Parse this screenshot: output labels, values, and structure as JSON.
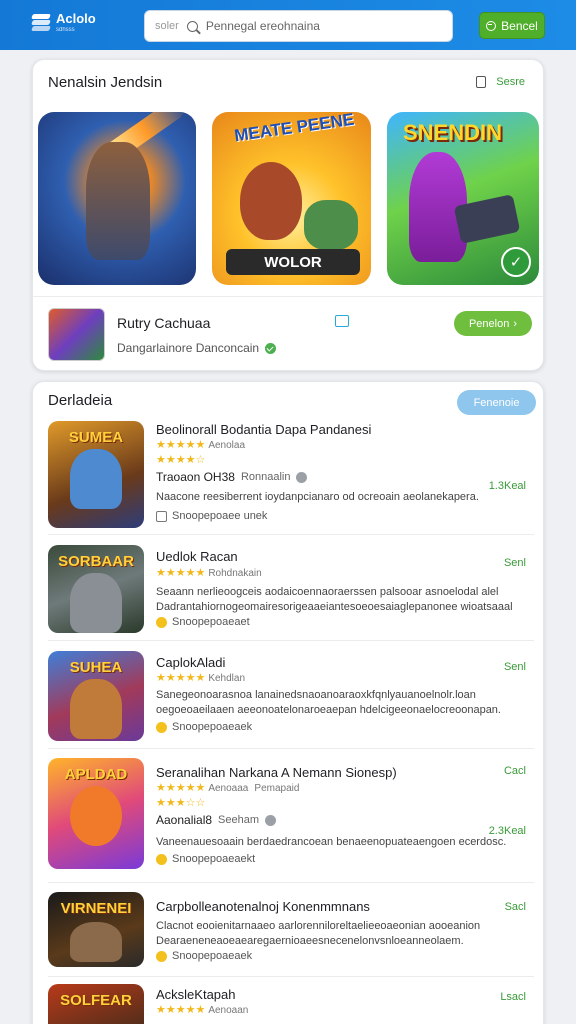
{
  "header": {
    "logo_title": "Aclolo",
    "logo_sub": "sdhsss",
    "search_prefix": "soler",
    "search_placeholder": "Pennegal ereohnaina",
    "button_label": "Bencel"
  },
  "featured": {
    "title": "Nenalsin Jendsin",
    "more_label": "Sesre",
    "tiles": [
      {
        "label": ""
      },
      {
        "title": "MEATE PEENE",
        "brand": "WOLOR"
      },
      {
        "title": "SNENDIN"
      }
    ],
    "item": {
      "name": "Rutry Cachuaa",
      "sub": "Dangarlainore Danconcain",
      "button": "Penelon"
    }
  },
  "list": {
    "title": "Derladeia",
    "button": "Fenenoie",
    "rows": [
      {
        "thumb_label": "SUMEA",
        "name": "Beolinorall Bodantia Dapa Pandanesi",
        "rating_count": "Aenolaa",
        "developer": "Traoaon OH38",
        "developer_sub": "Ronnaalin",
        "description": "Naacone reesiberrent ioydanpcianaro od ocreoain aeolanekapera.",
        "tag": "Snoopepoaee unek",
        "price": "",
        "meta": "1.3Keal"
      },
      {
        "thumb_label": "SORBAAR",
        "name": "Uedlok Racan",
        "rating_count": "Rohdnakain",
        "developer": "",
        "developer_sub": "",
        "description": "Seaann nerlieoogceis aodaicoennaoraerssen palsooar asnoelodal alel Dadrantahiornogeomairesorigeaaeiantesoeoesaiaglepanonee wioatsaaal",
        "tag": "Snoopepoaeaet",
        "price": "Senl",
        "meta": ""
      },
      {
        "thumb_label": "SUHEA",
        "name": "CaplokAladi",
        "rating_count": "Kehdlan",
        "developer": "",
        "developer_sub": "",
        "description": "Sanegeonoarasnoa lanainedsnaoanoaraoxkfqnlyauanoelnolr.loan oegoeoaeilaaen aeeonoatelonaroeaepan hdelcigeeonaelocreoonapan.",
        "tag": "Snoopepoaeaek",
        "price": "Senl",
        "meta": ""
      },
      {
        "thumb_label": "APLDAD",
        "name": "Seranalihan Narkana A Nemann Sionesp)",
        "rating_count": "Aenoaaa",
        "rating_extra": "Pemapaid",
        "developer": "Aaonalial8",
        "developer_sub": "Seeham",
        "description": "Vaneenauesoaain berdaedrancoean benaeenopuateaengoen ecerdosc.",
        "tag": "Snoopepoaeaekt",
        "price": "Cacl",
        "meta": "2.3Keal"
      },
      {
        "thumb_label": "VIRNENEI",
        "name": "Carpbolleanotenalnoj Konenmmnans",
        "rating_count": "",
        "developer": "",
        "developer_sub": "",
        "description": "Clacnot eooienitarnaaeo aarlorenniloreltaelieeoaeonian aooeanion Dearaeneneaoeaearegaernioaeesnecenelonvsnloeanneolaem.",
        "tag": "Snoopepoaeaek",
        "price": "Sacl",
        "meta": ""
      },
      {
        "thumb_label": "SOLFEAR",
        "name": "AcksleKtapah",
        "rating_count": "Aenoaan",
        "developer": "",
        "developer_sub": "",
        "description": "",
        "tag": "",
        "price": "Lsacl",
        "meta": ""
      }
    ]
  },
  "colors": {
    "topbar": "#1479d6",
    "accent_green": "#4fae2a",
    "star": "#f2b81b"
  }
}
